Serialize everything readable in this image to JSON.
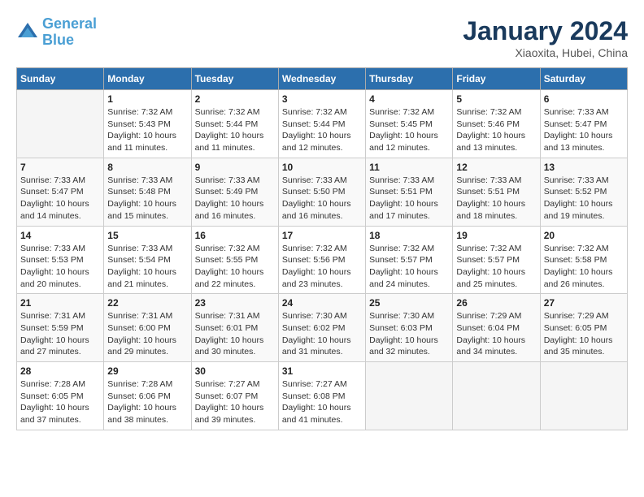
{
  "app": {
    "name": "GeneralBlue",
    "name_part1": "General",
    "name_part2": "Blue"
  },
  "calendar": {
    "month": "January 2024",
    "location": "Xiaoxita, Hubei, China",
    "headers": [
      "Sunday",
      "Monday",
      "Tuesday",
      "Wednesday",
      "Thursday",
      "Friday",
      "Saturday"
    ],
    "weeks": [
      [
        {
          "day": "",
          "sunrise": "",
          "sunset": "",
          "daylight": ""
        },
        {
          "day": "1",
          "sunrise": "Sunrise: 7:32 AM",
          "sunset": "Sunset: 5:43 PM",
          "daylight": "Daylight: 10 hours and 11 minutes."
        },
        {
          "day": "2",
          "sunrise": "Sunrise: 7:32 AM",
          "sunset": "Sunset: 5:44 PM",
          "daylight": "Daylight: 10 hours and 11 minutes."
        },
        {
          "day": "3",
          "sunrise": "Sunrise: 7:32 AM",
          "sunset": "Sunset: 5:44 PM",
          "daylight": "Daylight: 10 hours and 12 minutes."
        },
        {
          "day": "4",
          "sunrise": "Sunrise: 7:32 AM",
          "sunset": "Sunset: 5:45 PM",
          "daylight": "Daylight: 10 hours and 12 minutes."
        },
        {
          "day": "5",
          "sunrise": "Sunrise: 7:32 AM",
          "sunset": "Sunset: 5:46 PM",
          "daylight": "Daylight: 10 hours and 13 minutes."
        },
        {
          "day": "6",
          "sunrise": "Sunrise: 7:33 AM",
          "sunset": "Sunset: 5:47 PM",
          "daylight": "Daylight: 10 hours and 13 minutes."
        }
      ],
      [
        {
          "day": "7",
          "sunrise": "Sunrise: 7:33 AM",
          "sunset": "Sunset: 5:47 PM",
          "daylight": "Daylight: 10 hours and 14 minutes."
        },
        {
          "day": "8",
          "sunrise": "Sunrise: 7:33 AM",
          "sunset": "Sunset: 5:48 PM",
          "daylight": "Daylight: 10 hours and 15 minutes."
        },
        {
          "day": "9",
          "sunrise": "Sunrise: 7:33 AM",
          "sunset": "Sunset: 5:49 PM",
          "daylight": "Daylight: 10 hours and 16 minutes."
        },
        {
          "day": "10",
          "sunrise": "Sunrise: 7:33 AM",
          "sunset": "Sunset: 5:50 PM",
          "daylight": "Daylight: 10 hours and 16 minutes."
        },
        {
          "day": "11",
          "sunrise": "Sunrise: 7:33 AM",
          "sunset": "Sunset: 5:51 PM",
          "daylight": "Daylight: 10 hours and 17 minutes."
        },
        {
          "day": "12",
          "sunrise": "Sunrise: 7:33 AM",
          "sunset": "Sunset: 5:51 PM",
          "daylight": "Daylight: 10 hours and 18 minutes."
        },
        {
          "day": "13",
          "sunrise": "Sunrise: 7:33 AM",
          "sunset": "Sunset: 5:52 PM",
          "daylight": "Daylight: 10 hours and 19 minutes."
        }
      ],
      [
        {
          "day": "14",
          "sunrise": "Sunrise: 7:33 AM",
          "sunset": "Sunset: 5:53 PM",
          "daylight": "Daylight: 10 hours and 20 minutes."
        },
        {
          "day": "15",
          "sunrise": "Sunrise: 7:33 AM",
          "sunset": "Sunset: 5:54 PM",
          "daylight": "Daylight: 10 hours and 21 minutes."
        },
        {
          "day": "16",
          "sunrise": "Sunrise: 7:32 AM",
          "sunset": "Sunset: 5:55 PM",
          "daylight": "Daylight: 10 hours and 22 minutes."
        },
        {
          "day": "17",
          "sunrise": "Sunrise: 7:32 AM",
          "sunset": "Sunset: 5:56 PM",
          "daylight": "Daylight: 10 hours and 23 minutes."
        },
        {
          "day": "18",
          "sunrise": "Sunrise: 7:32 AM",
          "sunset": "Sunset: 5:57 PM",
          "daylight": "Daylight: 10 hours and 24 minutes."
        },
        {
          "day": "19",
          "sunrise": "Sunrise: 7:32 AM",
          "sunset": "Sunset: 5:57 PM",
          "daylight": "Daylight: 10 hours and 25 minutes."
        },
        {
          "day": "20",
          "sunrise": "Sunrise: 7:32 AM",
          "sunset": "Sunset: 5:58 PM",
          "daylight": "Daylight: 10 hours and 26 minutes."
        }
      ],
      [
        {
          "day": "21",
          "sunrise": "Sunrise: 7:31 AM",
          "sunset": "Sunset: 5:59 PM",
          "daylight": "Daylight: 10 hours and 27 minutes."
        },
        {
          "day": "22",
          "sunrise": "Sunrise: 7:31 AM",
          "sunset": "Sunset: 6:00 PM",
          "daylight": "Daylight: 10 hours and 29 minutes."
        },
        {
          "day": "23",
          "sunrise": "Sunrise: 7:31 AM",
          "sunset": "Sunset: 6:01 PM",
          "daylight": "Daylight: 10 hours and 30 minutes."
        },
        {
          "day": "24",
          "sunrise": "Sunrise: 7:30 AM",
          "sunset": "Sunset: 6:02 PM",
          "daylight": "Daylight: 10 hours and 31 minutes."
        },
        {
          "day": "25",
          "sunrise": "Sunrise: 7:30 AM",
          "sunset": "Sunset: 6:03 PM",
          "daylight": "Daylight: 10 hours and 32 minutes."
        },
        {
          "day": "26",
          "sunrise": "Sunrise: 7:29 AM",
          "sunset": "Sunset: 6:04 PM",
          "daylight": "Daylight: 10 hours and 34 minutes."
        },
        {
          "day": "27",
          "sunrise": "Sunrise: 7:29 AM",
          "sunset": "Sunset: 6:05 PM",
          "daylight": "Daylight: 10 hours and 35 minutes."
        }
      ],
      [
        {
          "day": "28",
          "sunrise": "Sunrise: 7:28 AM",
          "sunset": "Sunset: 6:05 PM",
          "daylight": "Daylight: 10 hours and 37 minutes."
        },
        {
          "day": "29",
          "sunrise": "Sunrise: 7:28 AM",
          "sunset": "Sunset: 6:06 PM",
          "daylight": "Daylight: 10 hours and 38 minutes."
        },
        {
          "day": "30",
          "sunrise": "Sunrise: 7:27 AM",
          "sunset": "Sunset: 6:07 PM",
          "daylight": "Daylight: 10 hours and 39 minutes."
        },
        {
          "day": "31",
          "sunrise": "Sunrise: 7:27 AM",
          "sunset": "Sunset: 6:08 PM",
          "daylight": "Daylight: 10 hours and 41 minutes."
        },
        {
          "day": "",
          "sunrise": "",
          "sunset": "",
          "daylight": ""
        },
        {
          "day": "",
          "sunrise": "",
          "sunset": "",
          "daylight": ""
        },
        {
          "day": "",
          "sunrise": "",
          "sunset": "",
          "daylight": ""
        }
      ]
    ]
  }
}
